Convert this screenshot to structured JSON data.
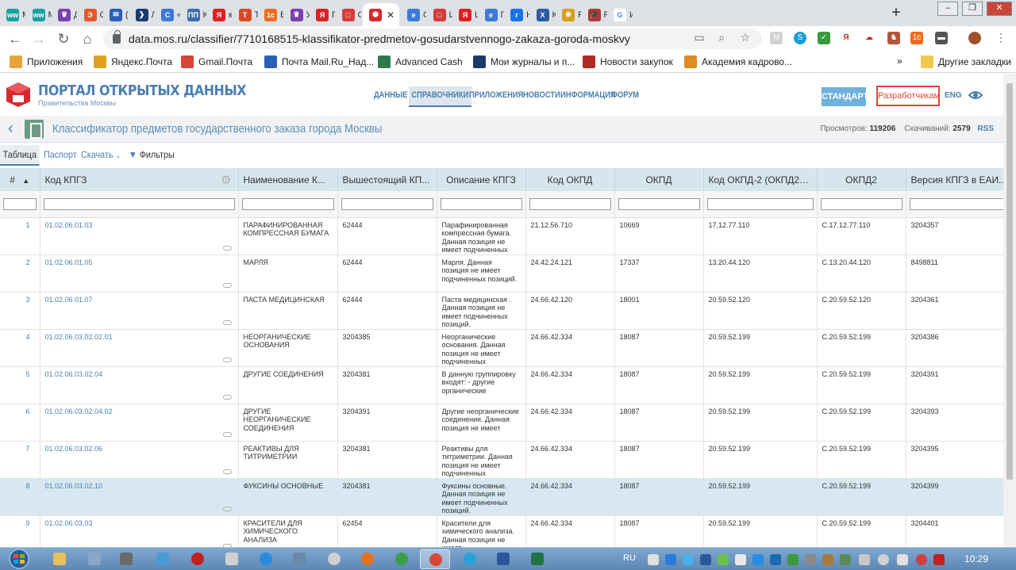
{
  "browser": {
    "tabs": [
      {
        "label": "M",
        "color": "#1aa1a1",
        "glyph": "ww"
      },
      {
        "label": "M",
        "color": "#1aa1a1",
        "glyph": "ww"
      },
      {
        "label": "Д",
        "color": "#7b3fb0",
        "glyph": "♛"
      },
      {
        "label": "Сс",
        "color": "#e2572b",
        "glyph": "Э"
      },
      {
        "label": "(5",
        "color": "#2a5fb7",
        "glyph": "✉"
      },
      {
        "label": "Лі",
        "color": "#1b3a6b",
        "glyph": "❯"
      },
      {
        "label": "«с",
        "color": "#3b7ad8",
        "glyph": "C"
      },
      {
        "label": "Ка",
        "color": "#3b6fa6",
        "glyph": "ПП"
      },
      {
        "label": "ка",
        "color": "#e02020",
        "glyph": "Я"
      },
      {
        "label": "Те",
        "color": "#d84a2a",
        "glyph": "Т"
      },
      {
        "label": "Бу",
        "color": "#f06b1c",
        "glyph": "1с"
      },
      {
        "label": "Уг",
        "color": "#7b3fb0",
        "glyph": "♛"
      },
      {
        "label": "Пр",
        "color": "#e02020",
        "glyph": "Я"
      },
      {
        "label": "Ст",
        "color": "#d83a3a",
        "glyph": "□"
      },
      {
        "label": "",
        "color": "#d8282e",
        "glyph": "⬢"
      },
      {
        "label": "Ок",
        "color": "#3b7ad8",
        "glyph": "e"
      },
      {
        "label": "Щ",
        "color": "#d83a3a",
        "glyph": "□"
      },
      {
        "label": "Щ",
        "color": "#e02020",
        "glyph": "Я"
      },
      {
        "label": "ГС",
        "color": "#3b7ad8",
        "glyph": "e"
      },
      {
        "label": "На",
        "color": "#1a73e8",
        "glyph": "r"
      },
      {
        "label": "Ко",
        "color": "#2c5aa0",
        "glyph": "X"
      },
      {
        "label": "Ра",
        "color": "#d8a020",
        "glyph": "❀"
      },
      {
        "label": "Ра",
        "color": "#b03a3a",
        "glyph": "🎓"
      },
      {
        "label": "Ин",
        "color": "#ffffff",
        "glyph": "G"
      }
    ],
    "active_tab_close": "✕",
    "new_tab": "+",
    "win_buttons": [
      "–",
      "❐",
      "✕"
    ],
    "url": "data.mos.ru/classifier/7710168515-klassifikator-predmetov-gosudarstvennogo-zakaza-goroda-moskvy",
    "bookmarks": [
      {
        "label": "Приложения",
        "color": "#e8a33c"
      },
      {
        "label": "Яндекс.Почта",
        "color": "#e0a020"
      },
      {
        "label": "Gmail.Почта",
        "color": "#d44638"
      },
      {
        "label": "Почта Mail.Ru_Над...",
        "color": "#2a5fb7"
      },
      {
        "label": "Advanced Cash",
        "color": "#2d7a4a"
      },
      {
        "label": "Мои журналы и п...",
        "color": "#1b3a6b"
      },
      {
        "label": "Новости закупок",
        "color": "#b02a2a"
      },
      {
        "label": "Академия кадрово...",
        "color": "#e08a20"
      }
    ],
    "bookmarks_more": "»",
    "other_bookmarks": "Другие закладки"
  },
  "portal": {
    "brand_title": "ПОРТАЛ ОТКРЫТЫХ ДАННЫХ",
    "brand_sub": "Правительства Москвы",
    "logo_text": "ОД",
    "nav": [
      "ДАННЫЕ",
      "СПРАВОЧНИКИ",
      "ПРИЛОЖЕНИЯ",
      "НОВОСТИ",
      "ИНФОРМАЦИЯ",
      "ФОРУМ"
    ],
    "standards_btn": "СТАНДАРТЫ",
    "devs_btn": "Разработчикам",
    "lang": "ENG"
  },
  "dataset": {
    "title": "Классификатор предметов государственного заказа города Москвы",
    "views_label": "Просмотров:",
    "views": "119206",
    "downloads_label": "Скачиваний:",
    "downloads": "2579",
    "rss": "RSS"
  },
  "subtabs": {
    "table": "Таблица",
    "passport": "Паспорт",
    "download": "Скачать",
    "filters": "Фильтры"
  },
  "table": {
    "columns": [
      "#",
      "Код КПГЗ",
      "Наименование К...",
      "Вышестоящий КП...",
      "Описание КПГЗ",
      "Код ОКПД",
      "ОКПД",
      "Код ОКПД-2 (ОКПД20...",
      "ОКПД2",
      "Версия КПГЗ в ЕАИ..."
    ],
    "rows": [
      {
        "n": "1",
        "code": "01.02.06.01.03",
        "name": "ПАРАФИНИРОВАННАЯ КОМПРЕССНАЯ БУМАГА",
        "parent": "62444",
        "desc": "Парафинированная компрессная бумага. Данная позиция не имеет подчиненных",
        "okpd_code": "21.12.56.710",
        "okpd": "10669",
        "okpd2_code": "17.12.77.110",
        "okpd2": "С.17.12.77.110",
        "version": "3204357"
      },
      {
        "n": "2",
        "code": "01.02.06.01.05",
        "name": "МАРЛЯ",
        "parent": "62444",
        "desc": "Марля. Данная позиция не имеет подчиненных позиций.",
        "okpd_code": "24.42.24.121",
        "okpd": "17337",
        "okpd2_code": "13.20.44.120",
        "okpd2": "С.13.20.44.120",
        "version": "8498811"
      },
      {
        "n": "3",
        "code": "01.02.06.01.07",
        "name": "ПАСТА МЕДИЦИНСКАЯ",
        "parent": "62444",
        "desc": "Паста медицинская . Данная позиция не имеет подчиненных позиций.",
        "okpd_code": "24.66.42.120",
        "okpd": "18001",
        "okpd2_code": "20.59.52.120",
        "okpd2": "С.20.59.52.120",
        "version": "3204361"
      },
      {
        "n": "4",
        "code": "01.02.06.03.02.02.01",
        "name": "НЕОРГАНИЧЕСКИЕ ОСНОВАНИЯ",
        "parent": "3204385",
        "desc": "Неорганические основания. Данная позиция не имеет подчиненных",
        "okpd_code": "24.66.42.334",
        "okpd": "18087",
        "okpd2_code": "20.59.52.199",
        "okpd2": "С.20.59.52.199",
        "version": "3204386"
      },
      {
        "n": "5",
        "code": "01.02.06.03.02.04",
        "name": "ДРУГИЕ СОЕДИНЕНИЯ",
        "parent": "3204381",
        "desc": "В данную группировку входят: - другие органические",
        "okpd_code": "24.66.42.334",
        "okpd": "18087",
        "okpd2_code": "20.59.52.199",
        "okpd2": "С.20.59.52.199",
        "version": "3204391"
      },
      {
        "n": "6",
        "code": "01.02.06.03.02.04.02",
        "name": "ДРУГИЕ НЕОРГАНИЧЕСКИЕ СОЕДИНЕНИЯ",
        "parent": "3204391",
        "desc": "Другие неорганические соединения. Данная позиция не имеет",
        "okpd_code": "24.66.42.334",
        "okpd": "18087",
        "okpd2_code": "20.59.52.199",
        "okpd2": "С.20.59.52.199",
        "version": "3204393"
      },
      {
        "n": "7",
        "code": "01.02.06.03.02.06",
        "name": "РЕАКТИВЫ ДЛЯ ТИТРИМЕТРИИ",
        "parent": "3204381",
        "desc": "Реактивы для титриметрии. Данная позиция не имеет подчиненных",
        "okpd_code": "24.66.42.334",
        "okpd": "18087",
        "okpd2_code": "20.59.52.199",
        "okpd2": "С.20.59.52.199",
        "version": "3204395"
      },
      {
        "n": "8",
        "code": "01.02.06.03.02.10",
        "name": "ФУКСИНЫ ОСНОВНЫЕ",
        "parent": "3204381",
        "desc": "Фуксины основные. Данная позиция не имеет подчиненных позиций.",
        "okpd_code": "24.66.42.334",
        "okpd": "18087",
        "okpd2_code": "20.59.52.199",
        "okpd2": "С.20.59.52.199",
        "version": "3204399"
      },
      {
        "n": "9",
        "code": "01.02.06.03.03",
        "name": "КРАСИТЕЛИ ДЛЯ ХИМИЧЕСКОГО АНАЛИЗА",
        "parent": "62454",
        "desc": "Красители для химического анализа. Данная позиция не имеет",
        "okpd_code": "24.66.42.334",
        "okpd": "18087",
        "okpd2_code": "20.59.52.199",
        "okpd2": "С.20.59.52.199",
        "version": "3204401"
      }
    ]
  },
  "taskbar": {
    "lang": "RU",
    "clock": "10:29"
  }
}
